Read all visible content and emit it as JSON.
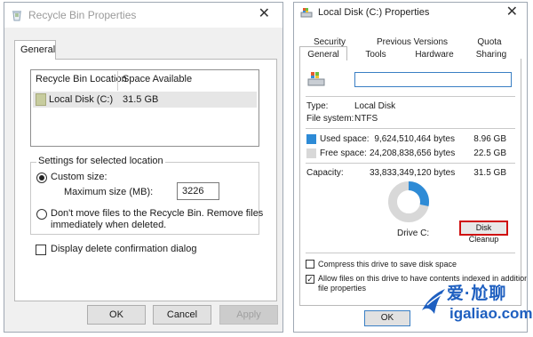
{
  "recycle_dialog": {
    "title": "Recycle Bin Properties",
    "tab": "General",
    "columns": [
      "Recycle Bin Location",
      "Space Available"
    ],
    "rows": [
      {
        "location": "Local Disk (C:)",
        "space": "31.5 GB"
      }
    ],
    "settings_legend": "Settings for selected location",
    "custom_size_label": "Custom size:",
    "max_size_label": "Maximum size (MB):",
    "max_size_value": "3226",
    "dont_move_line1": "Don't move files to the Recycle Bin. Remove files",
    "dont_move_line2": "immediately when deleted.",
    "display_confirm_label": "Display delete confirmation dialog",
    "ok": "OK",
    "cancel": "Cancel",
    "apply": "Apply"
  },
  "disk_dialog": {
    "title": "Local Disk (C:) Properties",
    "tabs_row1": [
      "Security",
      "Previous Versions",
      "Quota"
    ],
    "tabs_row2": [
      "General",
      "Tools",
      "Hardware",
      "Sharing"
    ],
    "name_value": "",
    "type_label": "Type:",
    "type_value": "Local Disk",
    "fs_label": "File system:",
    "fs_value": "NTFS",
    "used_label": "Used space:",
    "used_bytes": "9,624,510,464 bytes",
    "used_gb": "8.96 GB",
    "free_label": "Free space:",
    "free_bytes": "24,208,838,656 bytes",
    "free_gb": "22.5 GB",
    "capacity_label": "Capacity:",
    "capacity_bytes": "33,833,349,120 bytes",
    "capacity_gb": "31.5 GB",
    "used_fraction": 0.2845,
    "drive_label": "Drive C:",
    "cleanup": "Disk Cleanup",
    "compress_label": "Compress this drive to save disk space",
    "index_line1": "Allow files on this drive to have contents indexed in addition to",
    "index_line2": "file properties",
    "ok": "OK",
    "used_color": "#2e8bd6",
    "free_color": "#d8d8d8"
  },
  "watermark": {
    "top": "爱·尬聊",
    "bottom": "igaliao.com"
  }
}
